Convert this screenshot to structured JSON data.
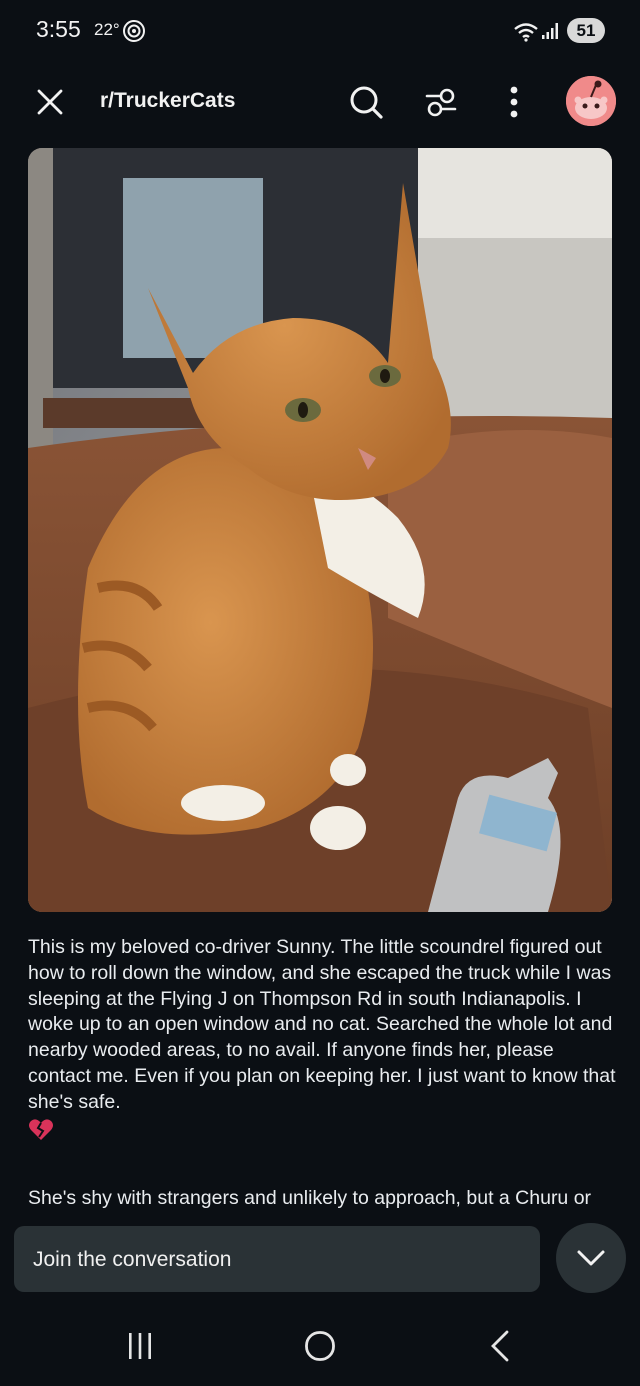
{
  "status": {
    "time": "3:55",
    "temperature": "22°",
    "battery": "51"
  },
  "header": {
    "subreddit": "r/TruckerCats",
    "icons": [
      "close-icon",
      "search-icon",
      "filter-icon",
      "more-vertical-icon",
      "avatar"
    ]
  },
  "post": {
    "image_alt": "orange tabby cat",
    "paragraphs": [
      "This is my beloved co-driver Sunny. The little scoundrel figured out how to roll down the window, and she escaped the truck while I was sleeping at the Flying J on Thompson Rd in south Indianapolis. I woke up to an open window and no cat. Searched the whole lot and nearby wooded areas, to no avail. If anyone finds her, please contact me. Even if you plan on keeping her. I just want to know that she's safe.",
      "She's shy with strangers and unlikely to approach, but a Churu or bacon will greatly increase your odds."
    ],
    "emoji": "broken-heart-icon"
  },
  "comment": {
    "placeholder": "Join the conversation"
  },
  "colors": {
    "background": "#0b0f14",
    "input": "#2a3236",
    "avatar": "#f08a8a"
  }
}
